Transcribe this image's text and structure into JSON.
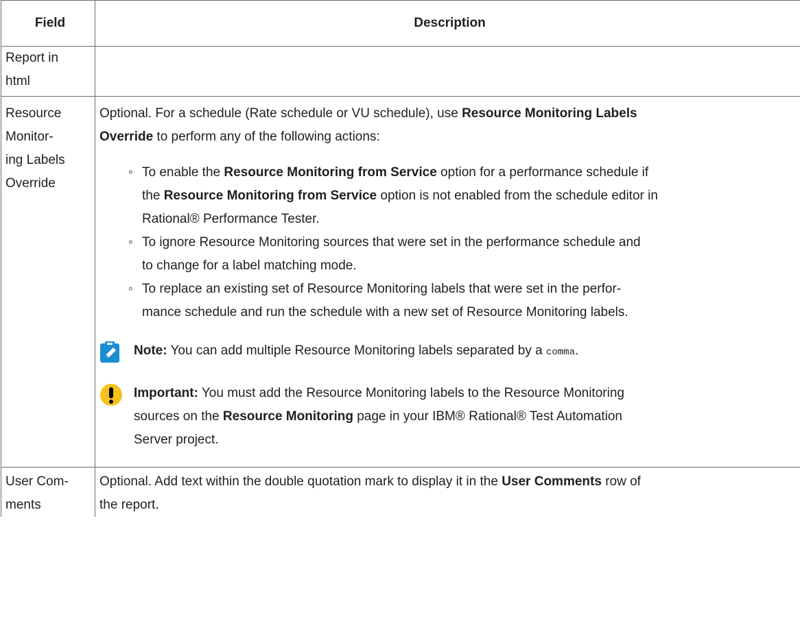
{
  "header": {
    "field": "Field",
    "description": "Description"
  },
  "rows": {
    "report": {
      "field_line1": "Report in",
      "field_line2": "html"
    },
    "resource": {
      "field_line1": "Resource",
      "field_line2": "Monitor-",
      "field_line3": "ing Labels",
      "field_line4": "Override",
      "intro_a": "Optional. For a schedule (Rate schedule or VU schedule), use ",
      "intro_b": "Resource Monitoring Labels",
      "intro_c": "Override",
      "intro_d": " to perform any of the following actions:",
      "bullet1_a": "To enable the ",
      "bullet1_b": "Resource Monitoring from Service",
      "bullet1_c": " option for a performance schedule if",
      "bullet1_d": "the ",
      "bullet1_e": "Resource Monitoring from Service",
      "bullet1_f": " option is not enabled from the schedule editor in",
      "bullet1_g": "Rational® Performance Tester.",
      "bullet2_a": "To ignore Resource Monitoring sources that were set in the performance schedule and",
      "bullet2_b": "to change for a label matching mode.",
      "bullet3_a": "To replace an existing set of Resource Monitoring labels that were set in the perfor-",
      "bullet3_b": "mance schedule and run the schedule with a new set of Resource Monitoring labels.",
      "note_label": "Note:",
      "note_text": " You can add multiple Resource Monitoring labels separated by a ",
      "note_code": "comma",
      "note_end": ".",
      "important_label": "Important:",
      "important_a": " You must add the Resource Monitoring labels to the Resource Monitoring",
      "important_b": "sources on the ",
      "important_c": "Resource Monitoring",
      "important_d": " page in your IBM® Rational® Test Automation",
      "important_e": "Server project."
    },
    "user": {
      "field_line1": "User Com-",
      "field_line2": "ments",
      "desc_a": "Optional. Add text within the double quotation mark to display it in the ",
      "desc_b": "User Comments",
      "desc_c": " row of",
      "desc_d": "the report."
    }
  },
  "icons": {
    "note": "pencil-note-icon",
    "important": "exclamation-icon"
  },
  "colors": {
    "note_icon_bg": "#1a8ed4",
    "important_icon_bg": "#f5c21b",
    "border": "#6a6a6a"
  }
}
